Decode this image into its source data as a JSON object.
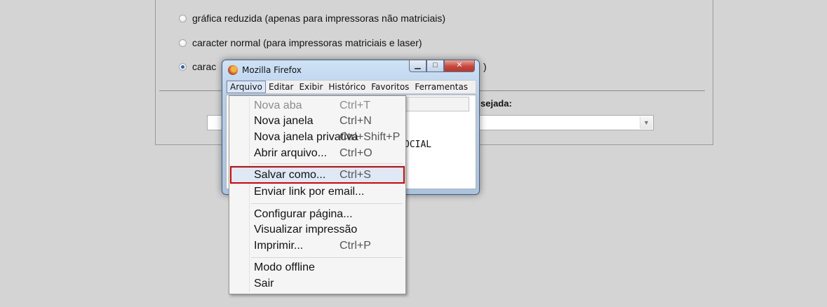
{
  "options": [
    {
      "label": "gráfica reduzida (apenas para impressoras não matriciais)",
      "checked": false
    },
    {
      "label": "caracter normal (para impressoras matriciais e laser)",
      "checked": false
    },
    {
      "label": "carac",
      "suffix": ")",
      "checked": true
    }
  ],
  "format_label": "sejada:",
  "preview_text": "OCIAL",
  "window": {
    "title": "Mozilla Firefox",
    "min": "▁",
    "max": "□",
    "close": "✕"
  },
  "menubar": [
    "Arquivo",
    "Editar",
    "Exibir",
    "Histórico",
    "Favoritos",
    "Ferramentas"
  ],
  "menu": [
    {
      "label": "Nova aba",
      "shortcut": "Ctrl+T",
      "enabled": false
    },
    {
      "label": "Nova janela",
      "shortcut": "Ctrl+N",
      "enabled": true
    },
    {
      "label": "Nova janela privativa",
      "shortcut": "Ctrl+Shift+P",
      "enabled": true
    },
    {
      "label": "Abrir arquivo...",
      "shortcut": "Ctrl+O",
      "enabled": true
    },
    {
      "label": "Salvar como...",
      "shortcut": "Ctrl+S",
      "enabled": true,
      "highlighted": true
    },
    {
      "label": "Enviar link por email...",
      "shortcut": "",
      "enabled": true
    },
    {
      "label": "Configurar página...",
      "shortcut": "",
      "enabled": true
    },
    {
      "label": "Visualizar impressão",
      "shortcut": "",
      "enabled": true
    },
    {
      "label": "Imprimir...",
      "shortcut": "Ctrl+P",
      "enabled": true
    },
    {
      "label": "Modo offline",
      "shortcut": "",
      "enabled": true
    },
    {
      "label": "Sair",
      "shortcut": "",
      "enabled": true
    }
  ],
  "colors": {
    "highlight_border": "#e00000",
    "background": "#d4d4d4"
  }
}
